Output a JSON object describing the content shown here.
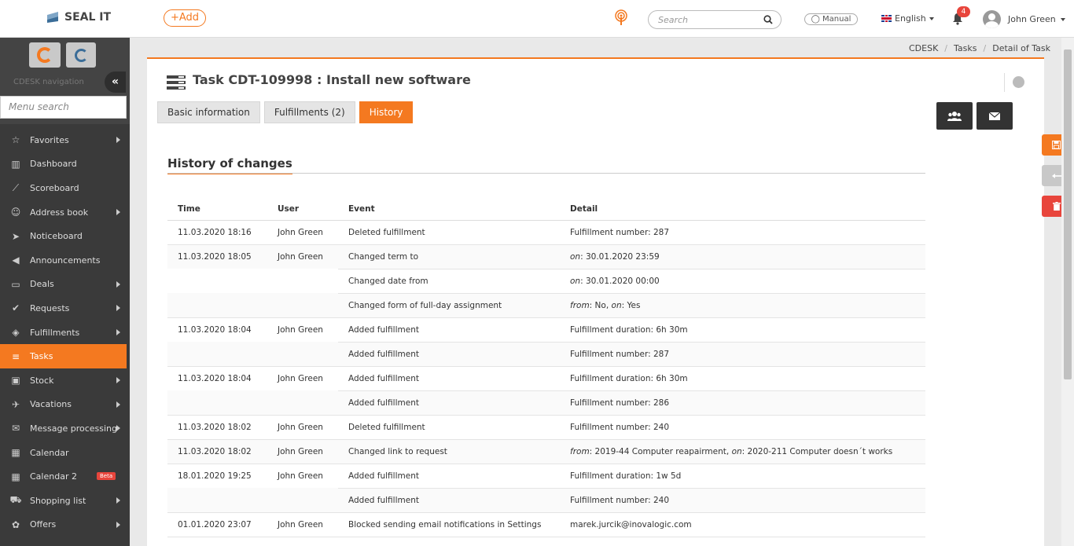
{
  "header": {
    "logo_text": "SEAL IT",
    "add_label": "+Add",
    "search_placeholder": "Search",
    "manual_label": "Manual",
    "language": "English",
    "notification_count": "4",
    "user_name": "John Green"
  },
  "sidebar": {
    "nav_label": "CDESK navigation",
    "menu_search_placeholder": "Menu search",
    "items": [
      {
        "label": "Favorites",
        "icon": "star-icon",
        "arrow": true
      },
      {
        "label": "Dashboard",
        "icon": "bar-chart-icon",
        "arrow": false
      },
      {
        "label": "Scoreboard",
        "icon": "line-chart-icon",
        "arrow": false
      },
      {
        "label": "Address book",
        "icon": "user-icon",
        "arrow": true
      },
      {
        "label": "Noticeboard",
        "icon": "paper-plane-icon",
        "arrow": false
      },
      {
        "label": "Announcements",
        "icon": "megaphone-icon",
        "arrow": false
      },
      {
        "label": "Deals",
        "icon": "card-icon",
        "arrow": true
      },
      {
        "label": "Requests",
        "icon": "check-circle-icon",
        "arrow": true
      },
      {
        "label": "Fulfillments",
        "icon": "cube-icon",
        "arrow": true
      },
      {
        "label": "Tasks",
        "icon": "tasks-icon",
        "arrow": false,
        "active": true
      },
      {
        "label": "Stock",
        "icon": "box-icon",
        "arrow": true
      },
      {
        "label": "Vacations",
        "icon": "plane-icon",
        "arrow": true
      },
      {
        "label": "Message processing",
        "icon": "envelope-icon",
        "arrow": true
      },
      {
        "label": "Calendar",
        "icon": "calendar-icon",
        "arrow": false
      },
      {
        "label": "Calendar 2",
        "icon": "calendar-icon",
        "arrow": false,
        "badge": "Beta"
      },
      {
        "label": "Shopping list",
        "icon": "cart-icon",
        "arrow": true
      },
      {
        "label": "Offers",
        "icon": "gift-icon",
        "arrow": true
      }
    ]
  },
  "breadcrumb": [
    "CDESK",
    "Tasks",
    "Detail of Task"
  ],
  "task": {
    "title": "Task CDT-109998 : Install new software"
  },
  "tabs": [
    {
      "label": "Basic information",
      "active": false
    },
    {
      "label": "Fulfillments (2)",
      "active": false
    },
    {
      "label": "History",
      "active": true
    }
  ],
  "history": {
    "title": "History of changes",
    "columns": [
      "Time",
      "User",
      "Event",
      "Detail"
    ],
    "rows": [
      {
        "time": "11.03.2020 18:16",
        "user": "John Green",
        "event": "Deleted fulfillment",
        "detail": [
          [
            "",
            "Fulfillment number: 287"
          ]
        ],
        "group_start": true,
        "group_end": true
      },
      {
        "time": "11.03.2020 18:05",
        "user": "John Green",
        "event": "Changed term to",
        "detail": [
          [
            "on",
            ": 30.01.2020 23:59"
          ]
        ],
        "group_start": true
      },
      {
        "time": "",
        "user": "",
        "event": "Changed date from",
        "detail": [
          [
            "on",
            ": 30.01.2020 00:00"
          ]
        ]
      },
      {
        "time": "",
        "user": "",
        "event": "Changed form of full-day assignment",
        "detail": [
          [
            "from",
            ": No, "
          ],
          [
            "on",
            ": Yes"
          ]
        ],
        "group_end": true
      },
      {
        "time": "11.03.2020 18:04",
        "user": "John Green",
        "event": "Added fulfillment",
        "detail": [
          [
            "",
            "Fulfillment duration: 6h 30m"
          ]
        ],
        "group_start": true
      },
      {
        "time": "",
        "user": "",
        "event": "Added fulfillment",
        "detail": [
          [
            "",
            "Fulfillment number: 287"
          ]
        ],
        "group_end": true
      },
      {
        "time": "11.03.2020 18:04",
        "user": "John Green",
        "event": "Added fulfillment",
        "detail": [
          [
            "",
            "Fulfillment duration: 6h 30m"
          ]
        ],
        "group_start": true
      },
      {
        "time": "",
        "user": "",
        "event": "Added fulfillment",
        "detail": [
          [
            "",
            "Fulfillment number: 286"
          ]
        ],
        "group_end": true
      },
      {
        "time": "11.03.2020 18:02",
        "user": "John Green",
        "event": "Deleted fulfillment",
        "detail": [
          [
            "",
            "Fulfillment number: 240"
          ]
        ],
        "group_start": true,
        "group_end": true
      },
      {
        "time": "11.03.2020 18:02",
        "user": "John Green",
        "event": "Changed link to request",
        "detail": [
          [
            "from",
            ": 2019-44 Computer reapairment, "
          ],
          [
            "on",
            ": 2020-211 Computer doesn´t works"
          ]
        ],
        "group_start": true,
        "group_end": true
      },
      {
        "time": "18.01.2020 19:25",
        "user": "John Green",
        "event": "Added fulfillment",
        "detail": [
          [
            "",
            "Fulfillment duration: 1w 5d"
          ]
        ],
        "group_start": true
      },
      {
        "time": "",
        "user": "",
        "event": "Added fulfillment",
        "detail": [
          [
            "",
            "Fulfillment number: 240"
          ]
        ],
        "group_end": true
      },
      {
        "time": "01.01.2020 23:07",
        "user": "John Green",
        "event": "Blocked sending email notifications in Settings",
        "detail": [
          [
            "",
            "marek.jurcik@inovalogic.com"
          ]
        ],
        "group_start": true,
        "group_end": true
      }
    ]
  },
  "colors": {
    "accent": "#f47920",
    "sidebar_bg": "#3a3a3a",
    "danger": "#e8453c",
    "dark_button": "#333333"
  }
}
